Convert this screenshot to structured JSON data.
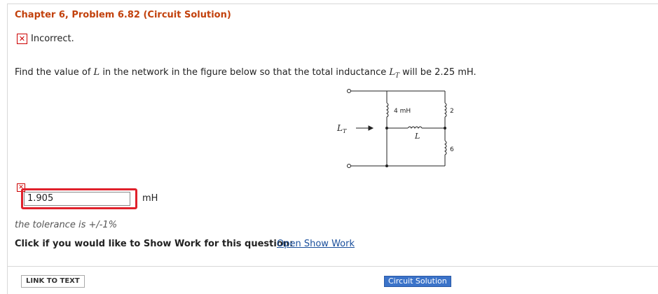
{
  "header": {
    "title": "Chapter 6, Problem 6.82 (Circuit Solution)"
  },
  "status": {
    "text": "Incorrect."
  },
  "question": {
    "before": "Find the value of ",
    "var": "L",
    "middle": " in the network in the figure below so that the total inductance ",
    "lt": "L",
    "lt_sub": "T",
    "after": " will be 2.25 mH."
  },
  "figure": {
    "lt_label": "L",
    "lt_sub": "T",
    "l1": "4 mH",
    "l2": "2 mH",
    "l3": "6 mH",
    "lvar": "L"
  },
  "answer": {
    "value": "1.905",
    "unit": "mH"
  },
  "tolerance": "the tolerance is +/-1%",
  "show_work": {
    "prompt": "Click if you would like to Show Work for this question:",
    "link": "Open Show Work"
  },
  "footer": {
    "link_text": "LINK TO TEXT",
    "circuit_solution": "Circuit Solution"
  }
}
